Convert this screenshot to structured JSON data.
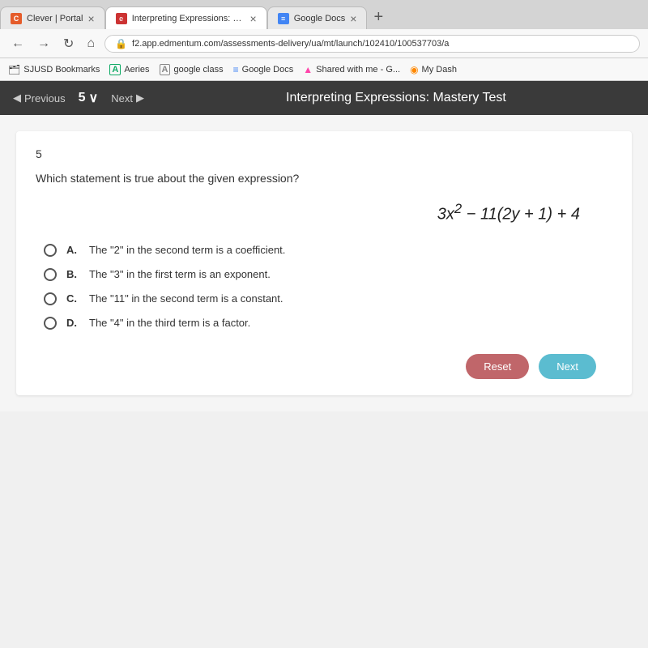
{
  "browser": {
    "tabs": [
      {
        "id": "tab-clever",
        "label": "Clever | Portal",
        "icon_color": "#e55c2a",
        "icon_letter": "C",
        "active": false
      },
      {
        "id": "tab-interpreting",
        "label": "Interpreting Expressions: Ma",
        "icon_color": "#d44",
        "icon_letter": "e",
        "active": true
      },
      {
        "id": "tab-google-docs",
        "label": "Google Docs",
        "icon_color": "#4285f4",
        "icon_letter": "≡",
        "active": false
      }
    ],
    "url": "f2.app.edmentum.com/assessments-delivery/ua/mt/launch/102410/100537703/a",
    "bookmarks": [
      {
        "label": "SJUSD Bookmarks"
      },
      {
        "label": "Aeries",
        "icon": "A"
      },
      {
        "label": "google class",
        "icon": "A"
      },
      {
        "label": "Google Docs",
        "icon": "≡"
      },
      {
        "label": "Shared with me - G...",
        "icon": "▲"
      },
      {
        "label": "My Dash",
        "icon": "◉"
      }
    ]
  },
  "assessment": {
    "prev_label": "Previous",
    "question_number": "5",
    "dropdown_icon": "∨",
    "next_label": "Next",
    "title": "Interpreting Expressions: Mastery Test"
  },
  "question": {
    "number": "5",
    "prompt": "Which statement is true about the given expression?",
    "expression": "3x² − 11(2y + 1) + 4",
    "options": [
      {
        "letter": "A",
        "text": "The \"2\" in the second term is a coefficient."
      },
      {
        "letter": "B",
        "text": "The \"3\" in the first term is an exponent."
      },
      {
        "letter": "C",
        "text": "The \"11\" in the second term is a constant."
      },
      {
        "letter": "D",
        "text": "The \"4\" in the third term is a factor."
      }
    ],
    "reset_label": "Reset",
    "next_label": "Next"
  }
}
